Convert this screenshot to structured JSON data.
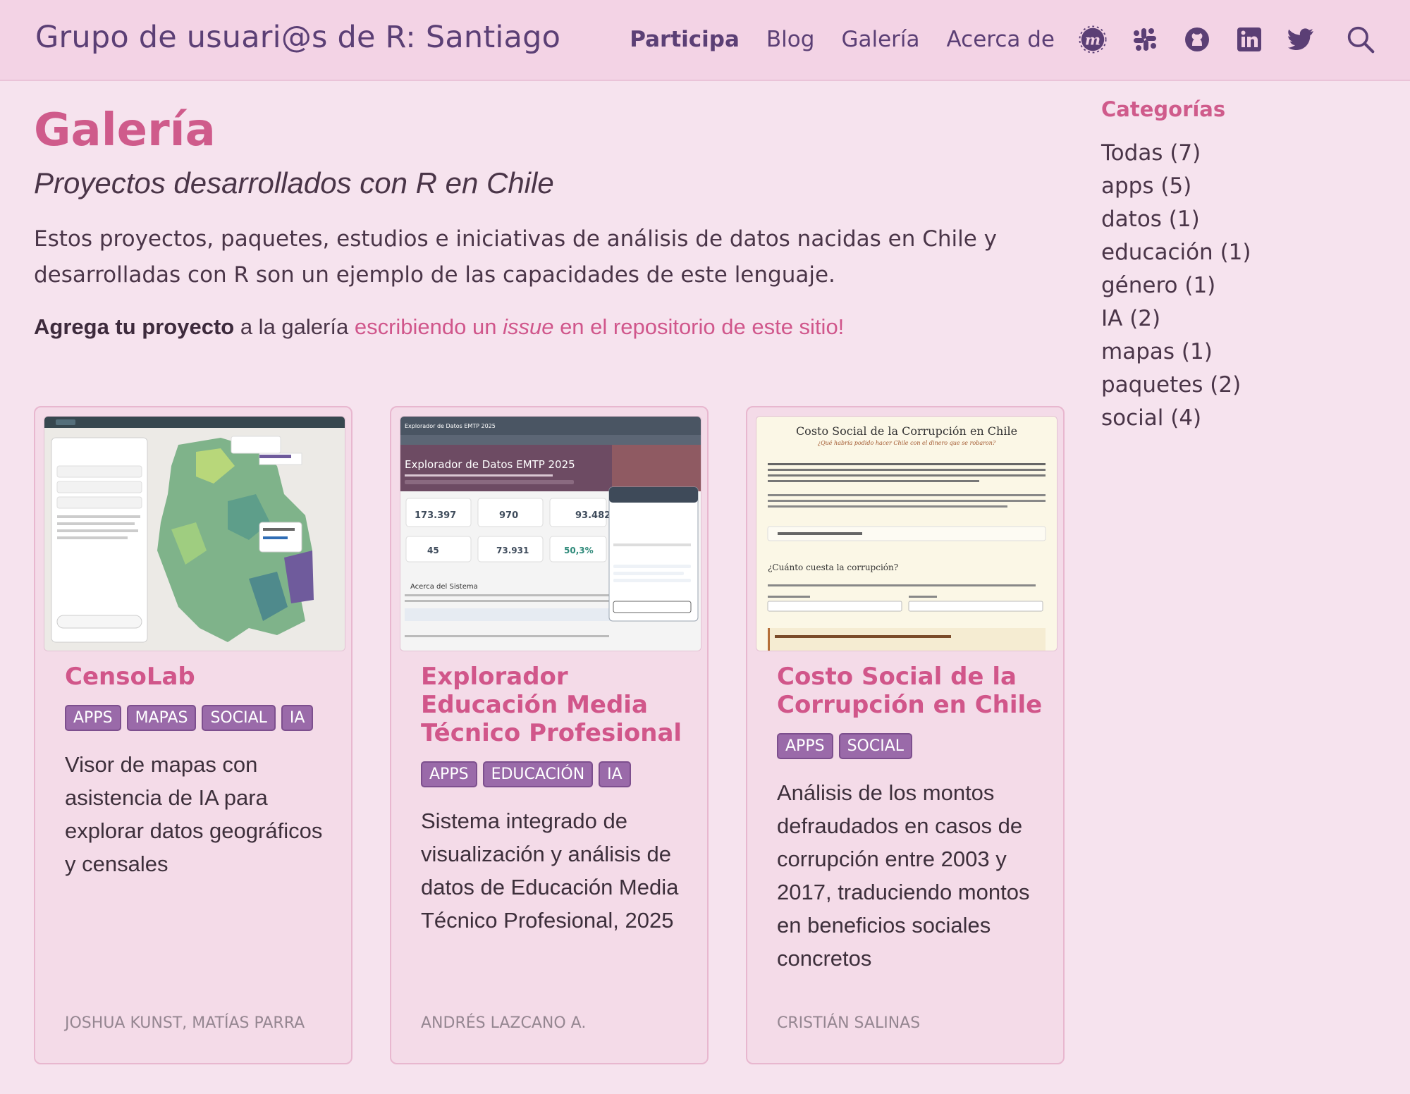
{
  "navbar": {
    "brand": "Grupo de usuari@s de R: Santiago",
    "links": [
      {
        "label": "Participa",
        "active": true
      },
      {
        "label": "Blog"
      },
      {
        "label": "Galería"
      },
      {
        "label": "Acerca de"
      }
    ],
    "icons": [
      "meetup-icon",
      "slack-icon",
      "github-icon",
      "linkedin-icon",
      "twitter-icon",
      "search-icon"
    ]
  },
  "main": {
    "title": "Galería",
    "subtitle": "Proyectos desarrollados con R en Chile",
    "description": "Estos proyectos, paquetes, estudios e iniciativas de análisis de datos nacidas en Chile y desarrolladas con R son un ejemplo de las capacidades de este lenguaje.",
    "add_bold": "Agrega tu proyecto",
    "add_text": " a la galería ",
    "add_link_before": "escribiendo un ",
    "add_link_italic": "issue",
    "add_link_after": " en el repositorio de este sitio!"
  },
  "cards": [
    {
      "title": "CensoLab",
      "tags": [
        "APPS",
        "MAPAS",
        "SOCIAL",
        "IA"
      ],
      "description": "Visor de mapas con asistencia de IA para explorar datos geográficos y censales",
      "author": "JOSHUA KUNST, MATÍAS PARRA"
    },
    {
      "title": "Explorador Educación Media Técnico Profesional",
      "tags": [
        "APPS",
        "EDUCACIÓN",
        "IA"
      ],
      "description": "Sistema integrado de visualización y análisis de datos de Educación Media Técnico Profesional, 2025",
      "author": "ANDRÉS LAZCANO A.",
      "thumb": {
        "header": "Explorador de Datos EMTP 2025",
        "stats": [
          "173.397",
          "970",
          "93.482",
          "45",
          "73.931",
          "50,3%"
        ],
        "section": "Acerca del Sistema"
      }
    },
    {
      "title": "Costo Social de la Corrupción en Chile",
      "tags": [
        "APPS",
        "SOCIAL"
      ],
      "description": "Análisis de los montos defraudados en casos de corrupción entre 2003 y 2017, traduciendo montos en beneficios sociales concretos",
      "author": "CRISTIÁN SALINAS",
      "thumb": {
        "title": "Costo Social de la Corrupción en Chile",
        "subtitle": "¿Qué habría podido hacer Chile con el dinero que se robaron?",
        "question": "¿Cuánto cuesta la corrupción?"
      }
    }
  ],
  "sidebar": {
    "title": "Categorías",
    "categories": [
      "Todas (7)",
      "apps (5)",
      "datos (1)",
      "educación (1)",
      "género (1)",
      "IA (2)",
      "mapas (1)",
      "paquetes (2)",
      "social (4)"
    ]
  },
  "colors": {
    "navbar_bg": "#f3d3e5",
    "page_bg": "#f6e3ee",
    "accent": "#cf5b8b",
    "brand": "#5b3f75",
    "tag_bg": "#9a6aa9"
  }
}
